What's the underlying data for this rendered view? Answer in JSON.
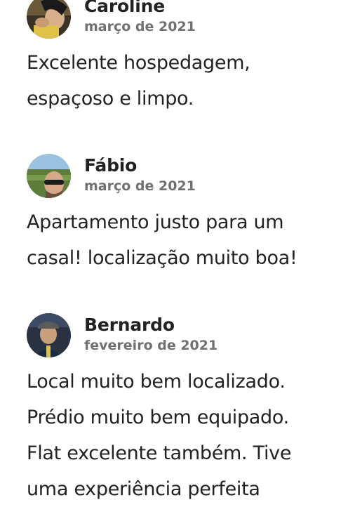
{
  "reviews": [
    {
      "name": "Caroline",
      "date": "março de 2021",
      "text_lines": [
        "Excelente hospedagem,",
        "espaçoso e limpo."
      ]
    },
    {
      "name": "Fábio",
      "date": "março de 2021",
      "text_lines": [
        "Apartamento justo para um",
        "casal! localização muito boa!"
      ]
    },
    {
      "name": "Bernardo",
      "date": "fevereiro de 2021",
      "text_lines": [
        "Local muito bem localizado.",
        "Prédio muito bem equipado.",
        "Flat excelente também. Tive",
        "uma experiência perfeita"
      ]
    }
  ],
  "colors": {
    "text_primary": "#222222",
    "text_secondary": "#717171",
    "background": "#ffffff"
  }
}
